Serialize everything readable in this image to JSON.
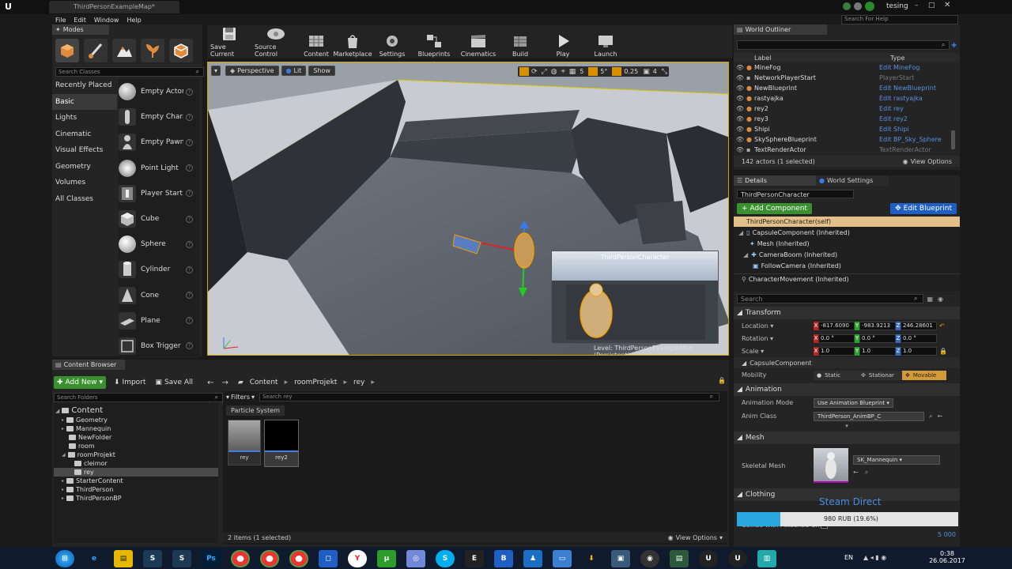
{
  "window": {
    "tab_title": "ThirdPersonExampleMap*",
    "user": "tesing",
    "search_help_placeholder": "Search For Help"
  },
  "menu": [
    "File",
    "Edit",
    "Window",
    "Help"
  ],
  "modes": {
    "title": "Modes",
    "search_placeholder": "Search Classes",
    "categories": [
      "Recently Placed",
      "Basic",
      "Lights",
      "Cinematic",
      "Visual Effects",
      "Geometry",
      "Volumes",
      "All Classes"
    ],
    "selected_category": "Basic",
    "items": [
      "Empty Actor",
      "Empty Chara",
      "Empty Pawn",
      "Point Light",
      "Player Start",
      "Cube",
      "Sphere",
      "Cylinder",
      "Cone",
      "Plane",
      "Box Trigger"
    ]
  },
  "toolbar": {
    "buttons": [
      "Save Current",
      "Source Control",
      "Content",
      "Marketplace",
      "Settings",
      "Blueprints",
      "Cinematics",
      "Build",
      "Play",
      "Launch"
    ]
  },
  "viewport": {
    "perspective": "Perspective",
    "lit": "Lit",
    "show": "Show",
    "grid_snap": "5",
    "rot_snap": "5°",
    "scale_snap": "0.25",
    "camera_speed": "4",
    "preview_title": "ThirdPersonCharacter",
    "level_label": "Level:",
    "level_name": "ThirdPersonExampleMap (Persistent)"
  },
  "outliner": {
    "title": "World Outliner",
    "col_label": "Label",
    "col_type": "Type",
    "rows": [
      {
        "name": "MineFog",
        "type": "Edit MineFog",
        "link": true
      },
      {
        "name": "NetworkPlayerStart",
        "type": "PlayerStart",
        "link": false
      },
      {
        "name": "NewBlueprint",
        "type": "Edit NewBlueprint",
        "link": true
      },
      {
        "name": "rastyajka",
        "type": "Edit rastyajka",
        "link": true
      },
      {
        "name": "rey2",
        "type": "Edit rey",
        "link": true
      },
      {
        "name": "rey3",
        "type": "Edit rey2",
        "link": true
      },
      {
        "name": "Shipi",
        "type": "Edit Shipi",
        "link": true
      },
      {
        "name": "SkySphereBlueprint",
        "type": "Edit BP_Sky_Sphere",
        "link": true
      },
      {
        "name": "TextRenderActor",
        "type": "TextRenderActor",
        "link": false
      }
    ],
    "status": "142 actors (1 selected)",
    "view_options": "View Options"
  },
  "details": {
    "tab_details": "Details",
    "tab_world": "World Settings",
    "actor_name": "ThirdPersonCharacter",
    "add_component": "+ Add Component",
    "edit_blueprint": "Edit Blueprint",
    "components": [
      {
        "name": "ThirdPersonCharacter(self)",
        "indent": 0
      },
      {
        "name": "CapsuleComponent (Inherited)",
        "indent": 1
      },
      {
        "name": "Mesh (Inherited)",
        "indent": 2
      },
      {
        "name": "CameraBoom (Inherited)",
        "indent": 2
      },
      {
        "name": "FollowCamera (Inherited)",
        "indent": 3
      },
      {
        "name": "CharacterMovement (Inherited)",
        "indent": 0
      }
    ],
    "search_placeholder": "Search",
    "transform_title": "Transform",
    "location_label": "Location",
    "rotation_label": "Rotation",
    "scale_label": "Scale",
    "location": [
      "-817.6090",
      "-983.9213",
      "246.28601"
    ],
    "rotation": [
      "0.0 °",
      "0.0 °",
      "0.0 °"
    ],
    "scale": [
      "1.0",
      "1.0",
      "1.0"
    ],
    "capsule_title": "CapsuleComponent",
    "mobility_label": "Mobility",
    "mobility": [
      "Static",
      "Stationar",
      "Movable"
    ],
    "animation_title": "Animation",
    "anim_mode_label": "Animation Mode",
    "anim_mode": "Use Animation Blueprint",
    "anim_class_label": "Anim Class",
    "anim_class": "ThirdPerson_AnimBP_C",
    "mesh_title": "Mesh",
    "skeletal_label": "Skeletal Mesh",
    "skeletal_value": "SK_Mannequin",
    "clothing_title": "Clothing",
    "collide_label": "Collide with Attached Ch"
  },
  "steam_overlay": {
    "title": "Steam Direct",
    "amount": "980 RUB (19.6%)",
    "goal": "5 000",
    "progress": 0.196
  },
  "content_browser": {
    "title": "Content Browser",
    "add_new": "Add New",
    "import": "Import",
    "save_all": "Save All",
    "path": [
      "Content",
      "roomProjekt",
      "rey"
    ],
    "search_folders": "Search Folders",
    "filters": "Filters",
    "search_placeholder": "Search rey",
    "category": "Particle System",
    "tree": [
      {
        "name": "Content",
        "indent": 0,
        "root": true
      },
      {
        "name": "Geometry",
        "indent": 1
      },
      {
        "name": "Mannequin",
        "indent": 1
      },
      {
        "name": "NewFolder",
        "indent": 1
      },
      {
        "name": "room",
        "indent": 1
      },
      {
        "name": "roomProjekt",
        "indent": 1
      },
      {
        "name": "cleimor",
        "indent": 2
      },
      {
        "name": "rey",
        "indent": 2,
        "selected": true
      },
      {
        "name": "StarterContent",
        "indent": 1
      },
      {
        "name": "ThirdPerson",
        "indent": 1
      },
      {
        "name": "ThirdPersonBP",
        "indent": 1
      }
    ],
    "assets": [
      "rey",
      "rey2"
    ],
    "status": "2 items (1 selected)",
    "view_options": "View Options"
  },
  "taskbar": {
    "lang": "EN",
    "time": "0:38",
    "date": "26.06.2017"
  }
}
